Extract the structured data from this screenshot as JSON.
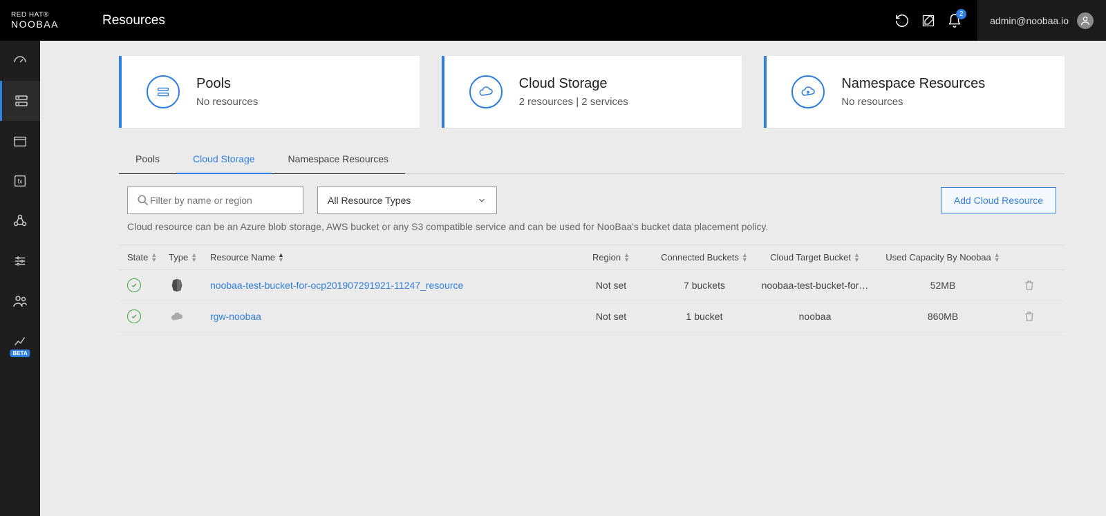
{
  "header": {
    "brand_line1": "RED HAT®",
    "brand_line2": "NOOBAA",
    "page_title": "Resources",
    "notification_count": "2",
    "user_email": "admin@noobaa.io"
  },
  "cards": [
    {
      "title": "Pools",
      "subtitle": "No resources"
    },
    {
      "title": "Cloud Storage",
      "subtitle": "2 resources | 2 services"
    },
    {
      "title": "Namespace Resources",
      "subtitle": "No resources"
    }
  ],
  "tabs": {
    "pools": "Pools",
    "cloud_storage": "Cloud Storage",
    "namespace": "Namespace Resources"
  },
  "filter": {
    "placeholder": "Filter by name or region",
    "type_select": "All Resource Types",
    "add_button": "Add Cloud Resource"
  },
  "help_text": "Cloud resource can be an Azure blob storage, AWS bucket or any S3 compatible service and can be used for NooBaa's bucket data placement policy.",
  "columns": {
    "state": "State",
    "type": "Type",
    "name": "Resource Name",
    "region": "Region",
    "buckets": "Connected Buckets",
    "target": "Cloud Target Bucket",
    "capacity": "Used Capacity By Noobaa"
  },
  "rows": [
    {
      "name": "noobaa-test-bucket-for-ocp201907291921-11247_resource",
      "region": "Not set",
      "buckets": "7 buckets",
      "target": "noobaa-test-bucket-for…",
      "capacity": "52MB",
      "type": "s3"
    },
    {
      "name": "rgw-noobaa",
      "region": "Not set",
      "buckets": "1 bucket",
      "target": "noobaa",
      "capacity": "860MB",
      "type": "cloud"
    }
  ]
}
